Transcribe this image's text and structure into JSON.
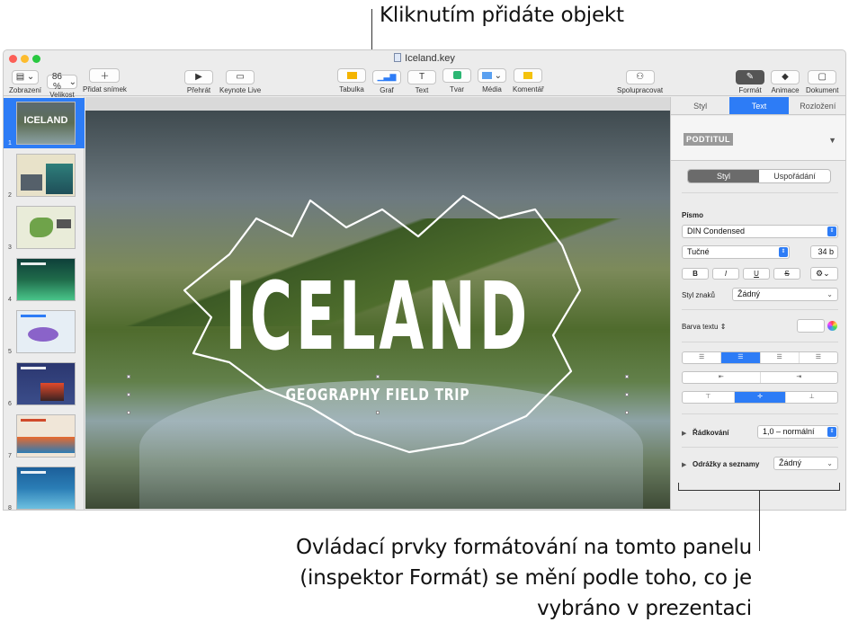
{
  "callouts": {
    "top": "Kliknutím přidáte objekt",
    "bottom_lines": [
      "Ovládací prvky formátování na tomto panelu",
      "(inspektor Formát) se mění podle toho, co je",
      "vybráno v prezentaci"
    ]
  },
  "window": {
    "title": "Iceland.key"
  },
  "toolbar": {
    "view": {
      "label": "Zobrazení",
      "icon": "sidebar-icon"
    },
    "zoom": {
      "label": "Velikost",
      "value": "86 %"
    },
    "add_slide": {
      "label": "Přidat snímek",
      "icon": "plus-icon"
    },
    "play": {
      "label": "Přehrát",
      "icon": "play-icon"
    },
    "keynote_live": {
      "label": "Keynote Live",
      "icon": "keynote-live-icon"
    },
    "table": {
      "label": "Tabulka",
      "icon": "table-icon"
    },
    "chart": {
      "label": "Graf",
      "icon": "chart-icon"
    },
    "text": {
      "label": "Text",
      "icon": "text-icon"
    },
    "shape": {
      "label": "Tvar",
      "icon": "shape-icon"
    },
    "media": {
      "label": "Média",
      "icon": "media-icon"
    },
    "comment": {
      "label": "Komentář",
      "icon": "comment-icon"
    },
    "collaborate": {
      "label": "Spolupracovat",
      "icon": "collaborate-icon"
    },
    "format": {
      "label": "Formát",
      "icon": "paintbrush-icon"
    },
    "animate": {
      "label": "Animace",
      "icon": "diamond-icon"
    },
    "document": {
      "label": "Dokument",
      "icon": "document-icon"
    }
  },
  "navigator": {
    "slides": [
      {
        "number": "1",
        "selected": true,
        "color": "#5d6e55"
      },
      {
        "number": "2",
        "selected": false,
        "color": "#e8e2c9"
      },
      {
        "number": "3",
        "selected": false,
        "color": "#e9ecd9"
      },
      {
        "number": "4",
        "selected": false,
        "color": "#1f6b4a"
      },
      {
        "number": "5",
        "selected": false,
        "color": "#e6eef5"
      },
      {
        "number": "6",
        "selected": false,
        "color": "#3b4d8a"
      },
      {
        "number": "7",
        "selected": false,
        "color": "#f0e6d8"
      },
      {
        "number": "8",
        "selected": false,
        "color": "#2a7db5"
      }
    ]
  },
  "slide": {
    "title": "ICELAND",
    "subtitle": "GEOGRAPHY FIELD TRIP"
  },
  "inspector": {
    "tabs": [
      "Styl",
      "Text",
      "Rozložení"
    ],
    "active_tab": "Text",
    "paragraph_style": "PODTITUL",
    "segments": [
      "Styl",
      "Uspořádání"
    ],
    "font_label": "Písmo",
    "font_family": "DIN Condensed",
    "font_style": "Tučné",
    "font_size": "34 b",
    "format_buttons": [
      "B",
      "I",
      "U",
      "S"
    ],
    "char_style_label": "Styl znaků",
    "char_style_value": "Žádný",
    "text_color_label": "Barva textu",
    "line_spacing_label": "Řádkování",
    "line_spacing_value": "1,0 – normální",
    "bullets_label": "Odrážky a seznamy",
    "bullets_value": "Žádný"
  }
}
